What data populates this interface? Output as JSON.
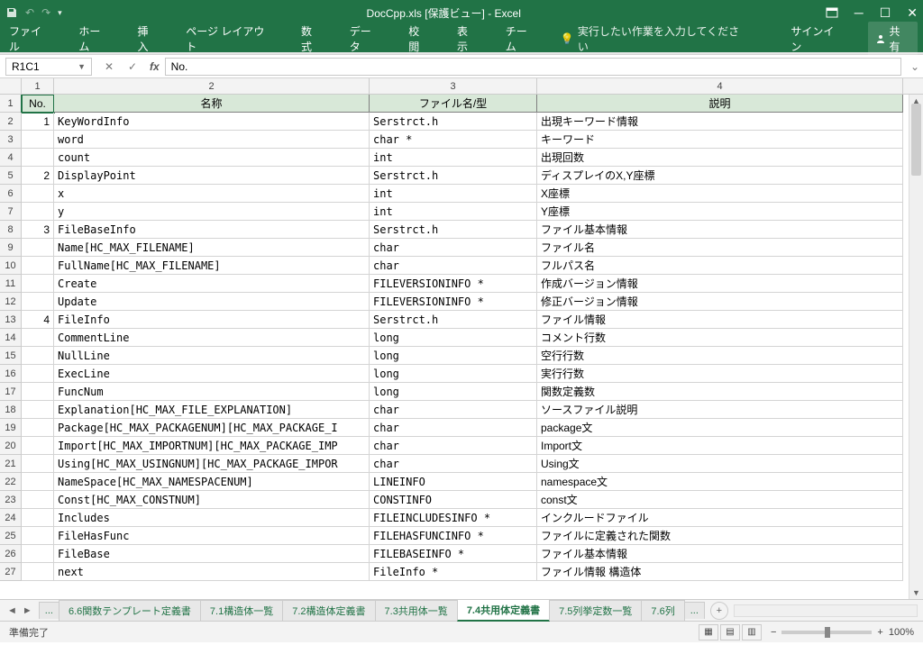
{
  "titlebar": {
    "title": "DocCpp.xls [保護ビュー] - Excel"
  },
  "ribbon": {
    "file": "ファイル",
    "home": "ホーム",
    "insert": "挿入",
    "pagelayout": "ページ レイアウト",
    "formulas": "数式",
    "data": "データ",
    "review": "校閲",
    "view": "表示",
    "team": "チーム",
    "tellme": "実行したい作業を入力してください",
    "signin": "サインイン",
    "share": "共有"
  },
  "formula": {
    "namebox": "R1C1",
    "value": "No."
  },
  "columns": [
    "1",
    "2",
    "3",
    "4"
  ],
  "headers": {
    "no": "No.",
    "name": "名称",
    "file": "ファイル名/型",
    "desc": "説明"
  },
  "rows": [
    {
      "r": "2",
      "no": "1",
      "name": "KeyWordInfo",
      "file": "Serstrct.h",
      "desc": "出現キーワード情報"
    },
    {
      "r": "3",
      "no": "",
      "name": "word",
      "file": "char *",
      "desc": "キーワード"
    },
    {
      "r": "4",
      "no": "",
      "name": "count",
      "file": "int",
      "desc": "出現回数"
    },
    {
      "r": "5",
      "no": "2",
      "name": "DisplayPoint",
      "file": "Serstrct.h",
      "desc": "ディスプレイのX,Y座標"
    },
    {
      "r": "6",
      "no": "",
      "name": "x",
      "file": "int",
      "desc": "X座標"
    },
    {
      "r": "7",
      "no": "",
      "name": "y",
      "file": "int",
      "desc": "Y座標"
    },
    {
      "r": "8",
      "no": "3",
      "name": "FileBaseInfo",
      "file": "Serstrct.h",
      "desc": "ファイル基本情報"
    },
    {
      "r": "9",
      "no": "",
      "name": "Name[HC_MAX_FILENAME]",
      "file": "char",
      "desc": "ファイル名"
    },
    {
      "r": "10",
      "no": "",
      "name": "FullName[HC_MAX_FILENAME]",
      "file": "char",
      "desc": "フルパス名"
    },
    {
      "r": "11",
      "no": "",
      "name": "Create",
      "file": "FILEVERSIONINFO *",
      "desc": "作成バージョン情報"
    },
    {
      "r": "12",
      "no": "",
      "name": "Update",
      "file": "FILEVERSIONINFO *",
      "desc": "修正バージョン情報"
    },
    {
      "r": "13",
      "no": "4",
      "name": "FileInfo",
      "file": "Serstrct.h",
      "desc": "ファイル情報"
    },
    {
      "r": "14",
      "no": "",
      "name": "CommentLine",
      "file": "long",
      "desc": "コメント行数"
    },
    {
      "r": "15",
      "no": "",
      "name": "NullLine",
      "file": "long",
      "desc": "空行行数"
    },
    {
      "r": "16",
      "no": "",
      "name": "ExecLine",
      "file": "long",
      "desc": "実行行数"
    },
    {
      "r": "17",
      "no": "",
      "name": "FuncNum",
      "file": "long",
      "desc": "関数定義数"
    },
    {
      "r": "18",
      "no": "",
      "name": "Explanation[HC_MAX_FILE_EXPLANATION]",
      "file": "char",
      "desc": "ソースファイル説明"
    },
    {
      "r": "19",
      "no": "",
      "name": "Package[HC_MAX_PACKAGENUM][HC_MAX_PACKAGE_I",
      "file": "char",
      "desc": "package文"
    },
    {
      "r": "20",
      "no": "",
      "name": "Import[HC_MAX_IMPORTNUM][HC_MAX_PACKAGE_IMP",
      "file": "char",
      "desc": "Import文"
    },
    {
      "r": "21",
      "no": "",
      "name": "Using[HC_MAX_USINGNUM][HC_MAX_PACKAGE_IMPOR",
      "file": "char",
      "desc": "Using文"
    },
    {
      "r": "22",
      "no": "",
      "name": "NameSpace[HC_MAX_NAMESPACENUM]",
      "file": "LINEINFO",
      "desc": "namespace文"
    },
    {
      "r": "23",
      "no": "",
      "name": "Const[HC_MAX_CONSTNUM]",
      "file": "CONSTINFO",
      "desc": "const文"
    },
    {
      "r": "24",
      "no": "",
      "name": "Includes",
      "file": "FILEINCLUDESINFO *",
      "desc": "インクルードファイル"
    },
    {
      "r": "25",
      "no": "",
      "name": "FileHasFunc",
      "file": "FILEHASFUNCINFO *",
      "desc": "ファイルに定義された関数"
    },
    {
      "r": "26",
      "no": "",
      "name": "FileBase",
      "file": "FILEBASEINFO *",
      "desc": "ファイル基本情報"
    },
    {
      "r": "27",
      "no": "",
      "name": "next",
      "file": "FileInfo *",
      "desc": "ファイル情報 構造体"
    }
  ],
  "sheets": {
    "ellipsis": "...",
    "t1": "6.6関数テンプレート定義書",
    "t2": "7.1構造体一覧",
    "t3": "7.2構造体定義書",
    "t4": "7.3共用体一覧",
    "active": "7.4共用体定義書",
    "t6": "7.5列挙定数一覧",
    "t7": "7.6列"
  },
  "status": {
    "ready": "準備完了",
    "zoom": "100%"
  }
}
